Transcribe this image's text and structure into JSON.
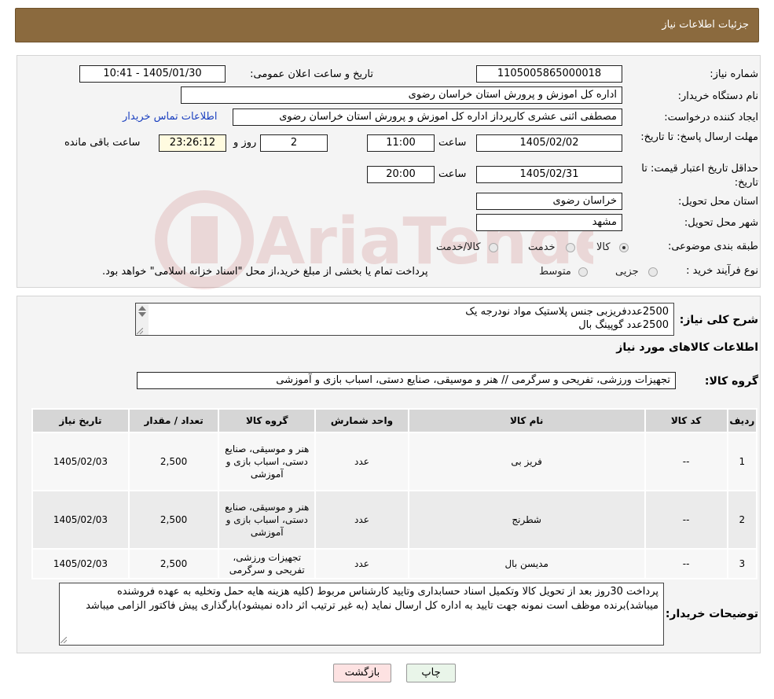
{
  "header": {
    "title": "جزئيات اطلاعات نياز"
  },
  "form": {
    "need_number_label": "شماره نیاز:",
    "need_number": "1105005865000018",
    "announce_label": "تاریخ و ساعت اعلان عمومی:",
    "announce_value": "1405/01/30 - 10:41",
    "buyer_org_label": "نام دستگاه خریدار:",
    "buyer_org": "اداره كل اموزش و پرورش استان خراسان رضوی",
    "requester_label": "ایجاد کننده درخواست:",
    "requester": "مصطفی اثنی عشری کارپرداز اداره كل اموزش و پرورش استان خراسان رضوی",
    "contact_link": "اطلاعات تماس خریدار",
    "deadline_label": "مهلت ارسال پاسخ: تا تاریخ:",
    "deadline_date": "1405/02/02",
    "time_label": "ساعت",
    "deadline_time": "11:00",
    "days_count": "2",
    "days_label": "روز و",
    "remaining_time": "23:26:12",
    "remaining_label": "ساعت باقی مانده",
    "validity_label": "حداقل تاریخ اعتبار قیمت: تا تاریخ:",
    "validity_date": "1405/02/31",
    "validity_time": "20:00",
    "province_label": "استان محل تحویل:",
    "province": "خراسان رضوی",
    "city_label": "شهر محل تحویل:",
    "city": "مشهد",
    "category_label": "طبقه بندی موضوعی:",
    "category_options": [
      "کالا",
      "خدمت",
      "کالا/خدمت"
    ],
    "category_selected": "کالا",
    "process_label": "نوع فرآیند خرید :",
    "process_options": [
      "جزیی",
      "متوسط"
    ],
    "payment_note": "پرداخت تمام یا بخشی از مبلغ خرید،از محل \"اسناد خزانه اسلامی\" خواهد بود."
  },
  "summary": {
    "label": "شرح کلی نیاز:",
    "lines": [
      "2500عددفریزبی جنس پلاستیک مواد نودرجه یک",
      "2500عدد گوپینگ بال"
    ]
  },
  "goods": {
    "section_title": "اطلاعات کالاهای مورد نیاز",
    "group_label": "گروه کالا:",
    "group_value": "تجهیزات ورزشی، تفریحی و سرگرمی // هنر و موسیقی، صنایع دستی، اسباب بازی و آموزشی",
    "columns": [
      "ردیف",
      "کد کالا",
      "نام کالا",
      "واحد شمارش",
      "گروه کالا",
      "تعداد / مقدار",
      "تاریخ نیاز"
    ],
    "rows": [
      {
        "row": "1",
        "code": "--",
        "name": "فریز بی",
        "unit": "عدد",
        "group": "هنر و موسیقی، صنایع دستی، اسباب بازی و آموزشی",
        "qty": "2,500",
        "date": "1405/02/03"
      },
      {
        "row": "2",
        "code": "--",
        "name": "شطرنج",
        "unit": "عدد",
        "group": "هنر و موسیقی، صنایع دستی، اسباب بازی و آموزشی",
        "qty": "2,500",
        "date": "1405/02/03"
      },
      {
        "row": "3",
        "code": "--",
        "name": "مدیسن بال",
        "unit": "عدد",
        "group": "تجهیزات ورزشی، تفریحی و سرگرمی",
        "qty": "2,500",
        "date": "1405/02/03"
      }
    ]
  },
  "buyer_notes": {
    "label": "توضیحات خریدار:",
    "text": "پرداخت 30روز بعد از تحویل کالا وتکمیل اسناد حسابداری وتایید کارشناس مربوط (کلیه هزینه هایه حمل وتخلیه به عهده فروشنده میباشد)برنده موظف است نمونه جهت تایید به اداره کل ارسال نماید (به غیر ترتیب اثر داده نمیشود)بارگذاری پیش فاکتور الزامی میباشد"
  },
  "buttons": {
    "print": "چاپ",
    "back": "بازگشت"
  },
  "watermark": {
    "text": "AriaTender.neT"
  },
  "colors": {
    "header_bg": "#8b6a3e",
    "link": "#1a3fbf",
    "highlight": "#fffbe0"
  }
}
